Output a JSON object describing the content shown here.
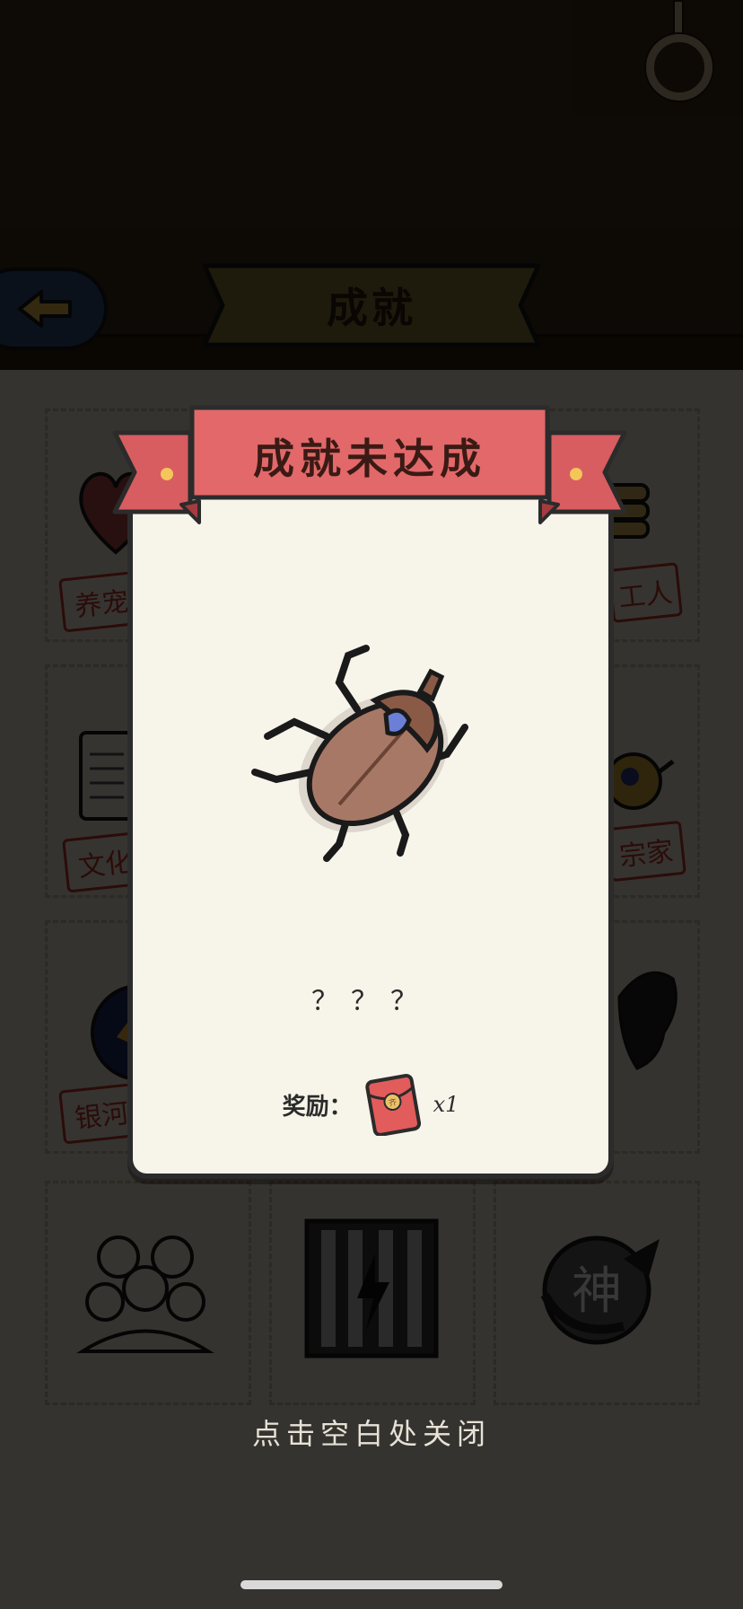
{
  "header": {
    "title": "成就"
  },
  "background_grid": {
    "stamps": [
      "养宠",
      "工人",
      "文化",
      "宗家",
      "银河"
    ],
    "bottom_badge_char": "神"
  },
  "modal": {
    "ribbon_title": "成就未达成",
    "achievement_name": "？？？",
    "reward_label": "奖励：",
    "reward_count": "x1",
    "envelope_char": "齐"
  },
  "footer": {
    "close_hint": "点击空白处关闭"
  },
  "colors": {
    "ribbon": "#e2686a",
    "card": "#f7f4ea",
    "beetle_shell": "#a87866",
    "beetle_eye": "#6c7fd6"
  }
}
